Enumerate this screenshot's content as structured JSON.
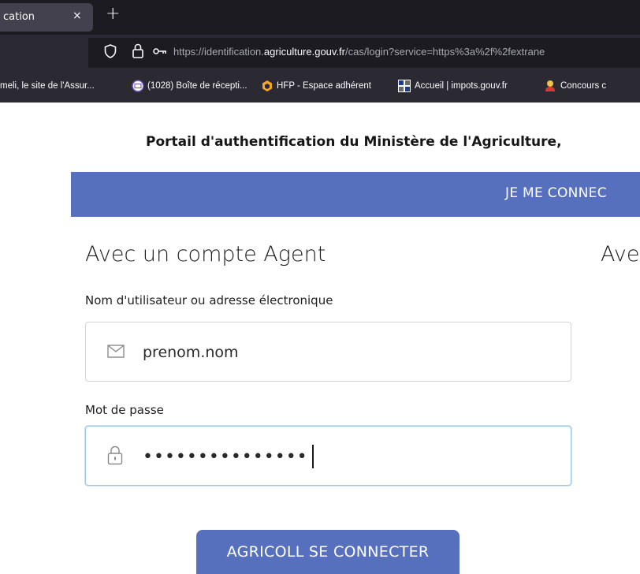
{
  "browser": {
    "tab_title": "cation",
    "tab_close": "×",
    "new_tab": "+",
    "url_prefix": "https://identification.",
    "url_domain": "agriculture.gouv.fr",
    "url_path": "/cas/login?service=https%3a%2f%2fextrane",
    "bookmarks": [
      "meli, le site de l'Assur...",
      "(1028) Boîte de récepti...",
      "HFP - Espace adhérent",
      "Accueil | impots.gouv.fr",
      "Concours c"
    ]
  },
  "page": {
    "portal_title": "Portail d'authentification du Ministère de l'Agriculture,",
    "banner_text": "JE ME CONNEC",
    "agent_heading": "Avec un compte Agent",
    "right_heading": "Ave",
    "username_label": "Nom d'utilisateur ou adresse électronique",
    "username_value": "prenom.nom",
    "password_label": "Mot de passe",
    "password_value": "•••••••••••••••",
    "submit_label": "AGRICOLL SE CONNECTER"
  },
  "colors": {
    "accent": "#5770be",
    "chrome_dark": "#1c1b22",
    "chrome_mid": "#2b2a33",
    "focus_border": "#9cc3e8"
  }
}
